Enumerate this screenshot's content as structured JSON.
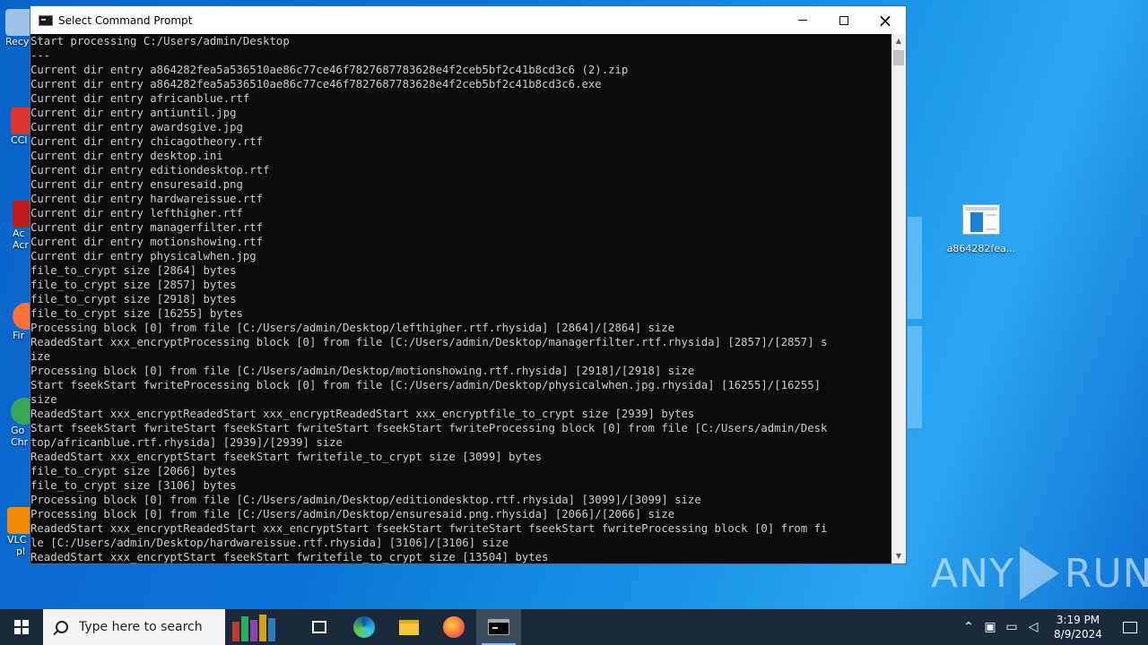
{
  "window": {
    "title": "Select Command Prompt",
    "controls": {
      "minimize": "minimize-icon",
      "maximize": "maximize-icon",
      "close": "×"
    }
  },
  "console_lines": [
    "Start processing C:/Users/admin/Desktop",
    "---",
    "Current dir entry a864282fea5a536510ae86c77ce46f7827687783628e4f2ceb5bf2c41b8cd3c6 (2).zip",
    "Current dir entry a864282fea5a536510ae86c77ce46f7827687783628e4f2ceb5bf2c41b8cd3c6.exe",
    "Current dir entry africanblue.rtf",
    "Current dir entry antiuntil.jpg",
    "Current dir entry awardsgive.jpg",
    "Current dir entry chicagotheory.rtf",
    "Current dir entry desktop.ini",
    "Current dir entry editiondesktop.rtf",
    "Current dir entry ensuresaid.png",
    "Current dir entry hardwareissue.rtf",
    "Current dir entry lefthigher.rtf",
    "Current dir entry managerfilter.rtf",
    "Current dir entry motionshowing.rtf",
    "Current dir entry physicalwhen.jpg",
    "file_to_crypt size [2864] bytes",
    "file_to_crypt size [2857] bytes",
    "file_to_crypt size [2918] bytes",
    "file_to_crypt size [16255] bytes",
    "Processing block [0] from file [C:/Users/admin/Desktop/lefthigher.rtf.rhysida] [2864]/[2864] size",
    "ReadedStart xxx_encryptProcessing block [0] from file [C:/Users/admin/Desktop/managerfilter.rtf.rhysida] [2857]/[2857] s",
    "ize",
    "Processing block [0] from file [C:/Users/admin/Desktop/motionshowing.rtf.rhysida] [2918]/[2918] size",
    "Start fseekStart fwriteProcessing block [0] from file [C:/Users/admin/Desktop/physicalwhen.jpg.rhysida] [16255]/[16255]",
    "size",
    "ReadedStart xxx_encryptReadedStart xxx_encryptReadedStart xxx_encryptfile_to_crypt size [2939] bytes",
    "Start fseekStart fwriteStart fseekStart fwriteStart fseekStart fwriteProcessing block [0] from file [C:/Users/admin/Desk",
    "top/africanblue.rtf.rhysida] [2939]/[2939] size",
    "ReadedStart xxx_encryptStart fseekStart fwritefile_to_crypt size [3099] bytes",
    "file_to_crypt size [2066] bytes",
    "file_to_crypt size [3106] bytes",
    "Processing block [0] from file [C:/Users/admin/Desktop/editiondesktop.rtf.rhysida] [3099]/[3099] size",
    "Processing block [0] from file [C:/Users/admin/Desktop/ensuresaid.png.rhysida] [2066]/[2066] size",
    "ReadedStart xxx_encryptReadedStart xxx_encryptStart fseekStart fwriteStart fseekStart fwriteProcessing block [0] from fi",
    "le [C:/Users/admin/Desktop/hardwareissue.rtf.rhysida] [3106]/[3106] size",
    "ReadedStart xxx_encryptStart fseekStart fwritefile_to_crypt size [13504] bytes"
  ],
  "desktop": {
    "left_icons": [
      {
        "label": "Recy",
        "icon": "recycle-bin-icon",
        "color": "#9fc3e6"
      },
      {
        "label": "CCl",
        "icon": "ccleaner-icon",
        "color": "#d33"
      },
      {
        "label": "Ac",
        "icon": "acrobat-icon",
        "color": "#c21a1a"
      },
      {
        "label": "Acr",
        "icon": "acrobat-icon",
        "color": "#c21a1a"
      },
      {
        "label": "Fir",
        "icon": "firefox-icon",
        "color": "#ff7139"
      },
      {
        "label": "Go",
        "icon": "chrome-icon",
        "color": "#3aa757"
      },
      {
        "label": "Chr",
        "icon": "chrome-icon",
        "color": "#3aa757"
      },
      {
        "label": "VLC",
        "icon": "vlc-icon",
        "color": "#f08a00"
      },
      {
        "label": "pl",
        "icon": "vlc-icon",
        "color": "#f08a00"
      }
    ],
    "file_icon_label": "a864282fea...",
    "watermark": {
      "left": "ANY",
      "right": "RUN"
    }
  },
  "taskbar": {
    "search_placeholder": "Type here to search",
    "clock_time": "3:19 PM",
    "clock_date": "8/9/2024",
    "tray_icons": [
      "chevron-up-icon",
      "meet-now-icon",
      "network-icon",
      "volume-icon"
    ]
  }
}
